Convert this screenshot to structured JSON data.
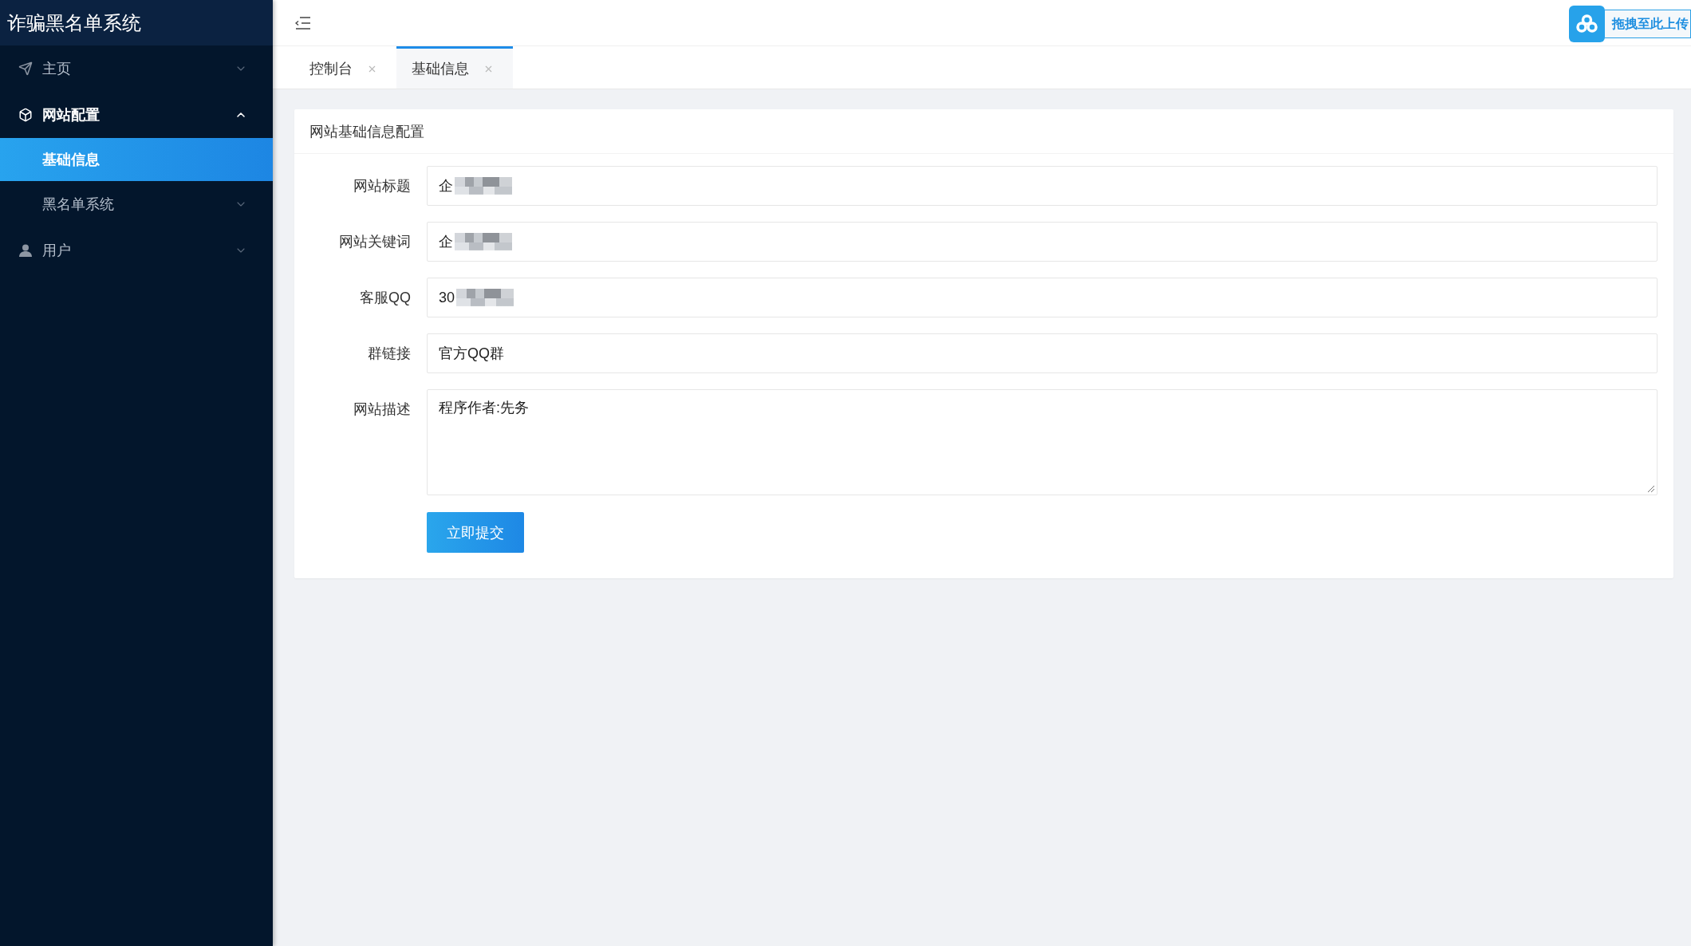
{
  "sidebar": {
    "title": "诈骗黑名单系统",
    "items": [
      {
        "label": "主页",
        "expanded": false,
        "selected": false
      },
      {
        "label": "网站配置",
        "expanded": true,
        "selected": false,
        "children": [
          {
            "label": "基础信息",
            "selected": true
          }
        ]
      },
      {
        "label": "黑名单系统",
        "expanded": false,
        "selected": false
      },
      {
        "label": "用户",
        "expanded": false,
        "selected": false
      }
    ]
  },
  "topbar": {
    "upload_button": {
      "label": "拖拽至此上传"
    }
  },
  "tabs": [
    {
      "label": "控制台",
      "selected": false
    },
    {
      "label": "基础信息",
      "selected": true
    }
  ],
  "form": {
    "title": "网站基础信息配置",
    "fields": [
      {
        "label": "网站标题",
        "kind": "input",
        "value": "企",
        "redacted": true
      },
      {
        "label": "网站关键词",
        "kind": "input",
        "value": "企",
        "redacted": true
      },
      {
        "label": "客服QQ",
        "kind": "input",
        "value": "30",
        "redacted": true
      },
      {
        "label": "群链接",
        "kind": "input",
        "value": "官方QQ群",
        "redacted": false
      },
      {
        "label": "网站描述",
        "kind": "textarea",
        "value": "程序作者:先务",
        "redacted": false
      }
    ],
    "submit": {
      "label": "立即提交"
    }
  }
}
